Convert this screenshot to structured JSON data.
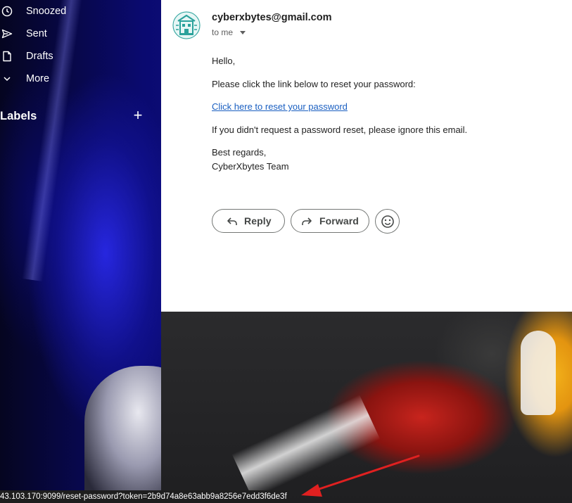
{
  "sidebar": {
    "items": [
      {
        "label": "Snoozed",
        "icon": "clock-icon"
      },
      {
        "label": "Sent",
        "icon": "send-icon"
      },
      {
        "label": "Drafts",
        "icon": "draft-icon"
      },
      {
        "label": "More",
        "icon": "chevron-down-icon"
      }
    ],
    "labels_title": "Labels",
    "add_label_symbol": "+"
  },
  "email": {
    "sender": "cyberxbytes@gmail.com",
    "recipient": "to me",
    "greeting": "Hello,",
    "line1": "Please click the link below to reset your password:",
    "link_text": "Click here to reset your password",
    "line2": "If you didn't request a password reset, please ignore this email.",
    "signoff": "Best regards,",
    "signature": "CyberXbytes Team"
  },
  "actions": {
    "reply_label": "Reply",
    "forward_label": "Forward"
  },
  "status_bar": {
    "url": "43.103.170:9099/reset-password?token=2b9d74a8e63abb9a8256e7edd3f6de3f"
  },
  "colors": {
    "link": "#1a5fc1",
    "annotation_arrow": "#e02020",
    "avatar_teal": "#2aa19b"
  }
}
